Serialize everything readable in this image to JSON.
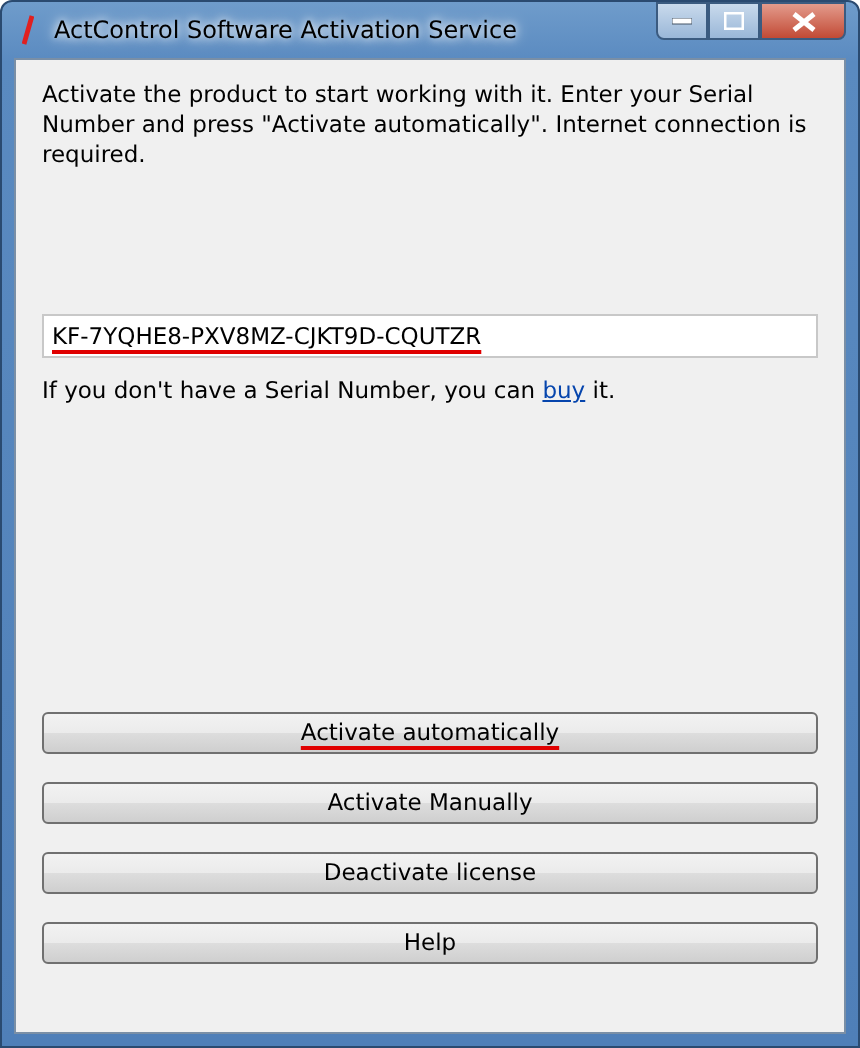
{
  "window": {
    "title": "ActControl Software Activation Service"
  },
  "intro": "Activate the product to start working with it. Enter your Serial Number and press \"Activate automatically\". Internet connection is required.",
  "serial": {
    "value": "KF-7YQHE8-PXV8MZ-CJKT9D-CQUTZR",
    "underlined": true
  },
  "help": {
    "before": "If you don't have a Serial Number, you can ",
    "link": "buy",
    "after": " it."
  },
  "buttons": [
    {
      "label": "Activate automatically",
      "underlined": true
    },
    {
      "label": "Activate Manually",
      "underlined": false
    },
    {
      "label": "Deactivate license",
      "underlined": false
    },
    {
      "label": "Help",
      "underlined": false
    }
  ]
}
